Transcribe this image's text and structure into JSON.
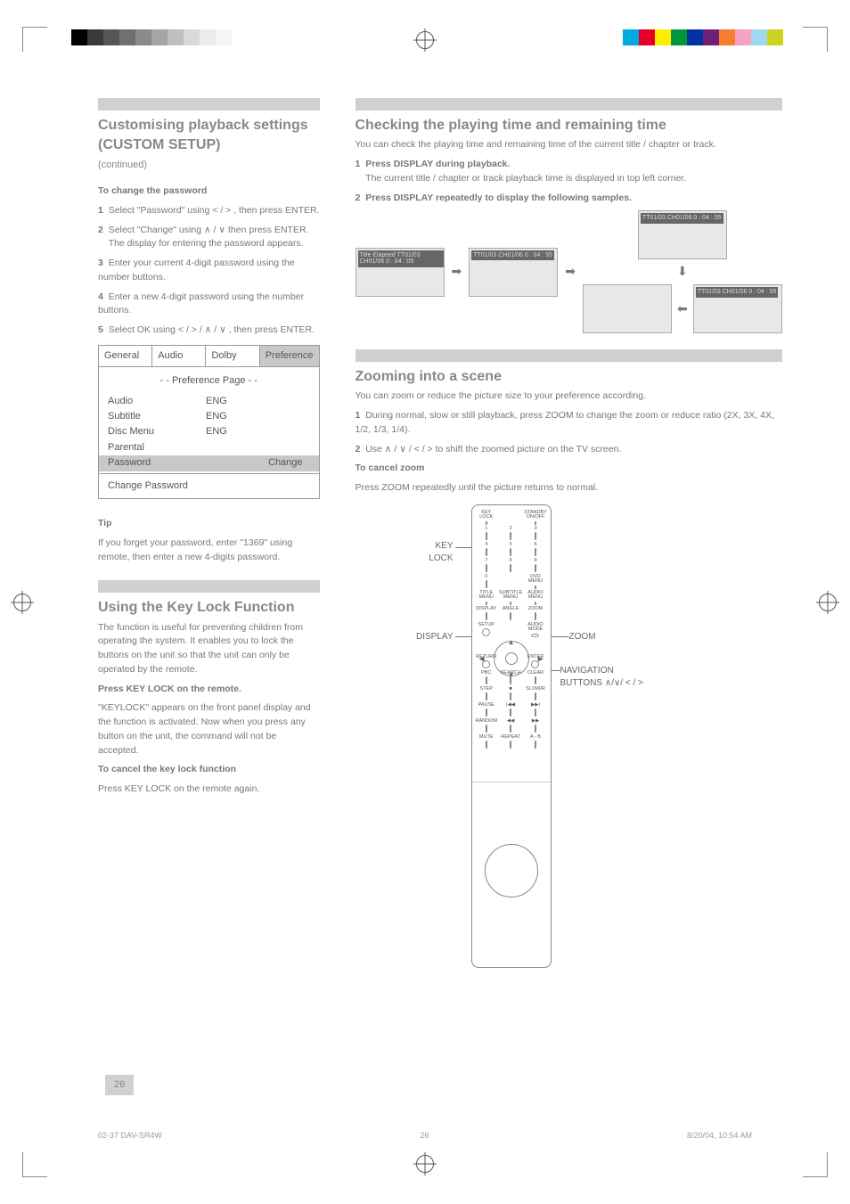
{
  "page_number": "26",
  "footer": {
    "left": "02-37 DAV-SR4W",
    "center": "26",
    "right": "8/20/04, 10:54 AM"
  },
  "colorbars": {
    "left": [
      "#000",
      "#3a3a3a",
      "#555",
      "#707070",
      "#8a8a8a",
      "#a5a5a5",
      "#bfbfbf",
      "#d9d9d9",
      "#ececec",
      "#f5f5f5",
      "#fff",
      "#fff"
    ],
    "right": [
      "#00a9e0",
      "#e4002b",
      "#ffed00",
      "#009639",
      "#0033a0",
      "#6d2077",
      "#f47d30",
      "#f7a1c4",
      "#a0d9ef",
      "#cdd420"
    ]
  },
  "left_col": {
    "header_title": "Customising playback settings (CUSTOM SETUP)",
    "header_sub": "(continued)",
    "section1_title": "To change the password",
    "steps": [
      "Select \"Password\" using  < / > , then press ENTER.",
      "Select \"Change\" using  ∧ / ∨  then press ENTER.",
      "The display for entering the password appears.",
      "Enter your current 4-digit password using the number buttons.",
      "Enter a new 4-digit password using the number buttons.",
      "Select OK using  < / > / ∧ / ∨ , then press ENTER."
    ],
    "menu": {
      "tabs": [
        "General",
        "Audio",
        "Dolby",
        "Preference"
      ],
      "selected_tab": 3,
      "title": "- -  Preference  Page  - -",
      "rows": [
        {
          "k": "Audio",
          "v": "ENG",
          "x": ""
        },
        {
          "k": "Subtitle",
          "v": "ENG",
          "x": ""
        },
        {
          "k": "Disc Menu",
          "v": "ENG",
          "x": ""
        },
        {
          "k": "Parental",
          "v": "",
          "x": ""
        },
        {
          "k": "Password",
          "v": "",
          "x": "Change",
          "sel": true
        }
      ],
      "footer": "Change Password"
    },
    "tip_title": "Tip",
    "tip_body": "If you forget your password, enter \"1369\" using remote, then enter a new 4-digits password.",
    "section2_title": "Using the Key Lock Function",
    "section2_body": "The function is useful for preventing children from operating the system. It enables you to lock the buttons on the unit so that the unit can only be operated by the remote.",
    "section2_step": "Press KEY LOCK on the remote.",
    "section2_after": "\"KEYLOCK\" appears on the front panel display and the function is activated. Now when you press any button on the unit, the command will not be accepted.",
    "section2_cancel_t": "To cancel the key lock function",
    "section2_cancel_b": "Press KEY LOCK on the remote again."
  },
  "right_col": {
    "header_title": "Checking the playing time and remaining time",
    "body1": "You can check the playing time and remaining time of the current title / chapter or track.",
    "step1": "Press DISPLAY during playback.",
    "step1_after": "The current title / chapter or track playback time is displayed in top left corner.",
    "step2": "Press DISPLAY repeatedly to display the following samples.",
    "tv_labels": [
      "Title Elapsed TT01/03 CH01/06\n0 : 04 : 05",
      "TT01/03 CH01/06\n0 : 04 : 55",
      "TT01/03 CH01/06\n0 : 04 : 55",
      "TT01/03 CH01/06\n0 : 04 : 55"
    ],
    "bottom_title": "Zooming into a scene",
    "bottom_body1": "You can zoom or reduce the picture size to your preference according.",
    "bottom_steps": [
      "During normal, slow or still playback, press ZOOM to change the zoom or reduce ratio (2X, 3X, 4X, 1/2, 1/3, 1/4).",
      "Use ∧ / ∨ / < / > to shift the zoomed picture on the TV screen."
    ],
    "bottom_cancel_t": "To cancel zoom",
    "bottom_cancel_b": "Press ZOOM repeatedly until the picture returns to normal.",
    "callouts": {
      "keylock": "KEY\nLOCK",
      "display": "DISPLAY",
      "zoom": "ZOOM",
      "nav": "NAVIGATION\nBUTTONS ∧/∨/ < / >"
    },
    "remote_labels": {
      "r1": [
        "KEY\nLOCK",
        "",
        "STANDBY\nON/OFF"
      ],
      "r2": [
        "1",
        "2",
        "3"
      ],
      "r3": [
        "4",
        "5",
        "6"
      ],
      "r4": [
        "7",
        "8",
        "9"
      ],
      "r5": [
        "0",
        "",
        "DVD\nMENU"
      ],
      "r6": [
        "TITLE\nMENU",
        "SUBTITLE\nMENU",
        "AUDIO\nMENU"
      ],
      "r7": [
        "DISPLAY",
        "ANGLE",
        "ZOOM"
      ],
      "r8": [
        "SETUP",
        "",
        "AUDIO\nMODE"
      ],
      "r9": [
        "RETURN",
        "",
        "ENTER"
      ],
      "r10": [
        "PBC",
        "SEARCH",
        "CLEAR"
      ],
      "r11": [
        "STEP",
        "■",
        "SLOW/R"
      ],
      "r12": [
        "PAUSE",
        "|◀◀",
        "▶▶|"
      ],
      "r13": [
        "RANDOM",
        "◀◀",
        "▶▶"
      ],
      "r14": [
        "MUTE",
        "REPEAT",
        "A - B"
      ]
    }
  }
}
